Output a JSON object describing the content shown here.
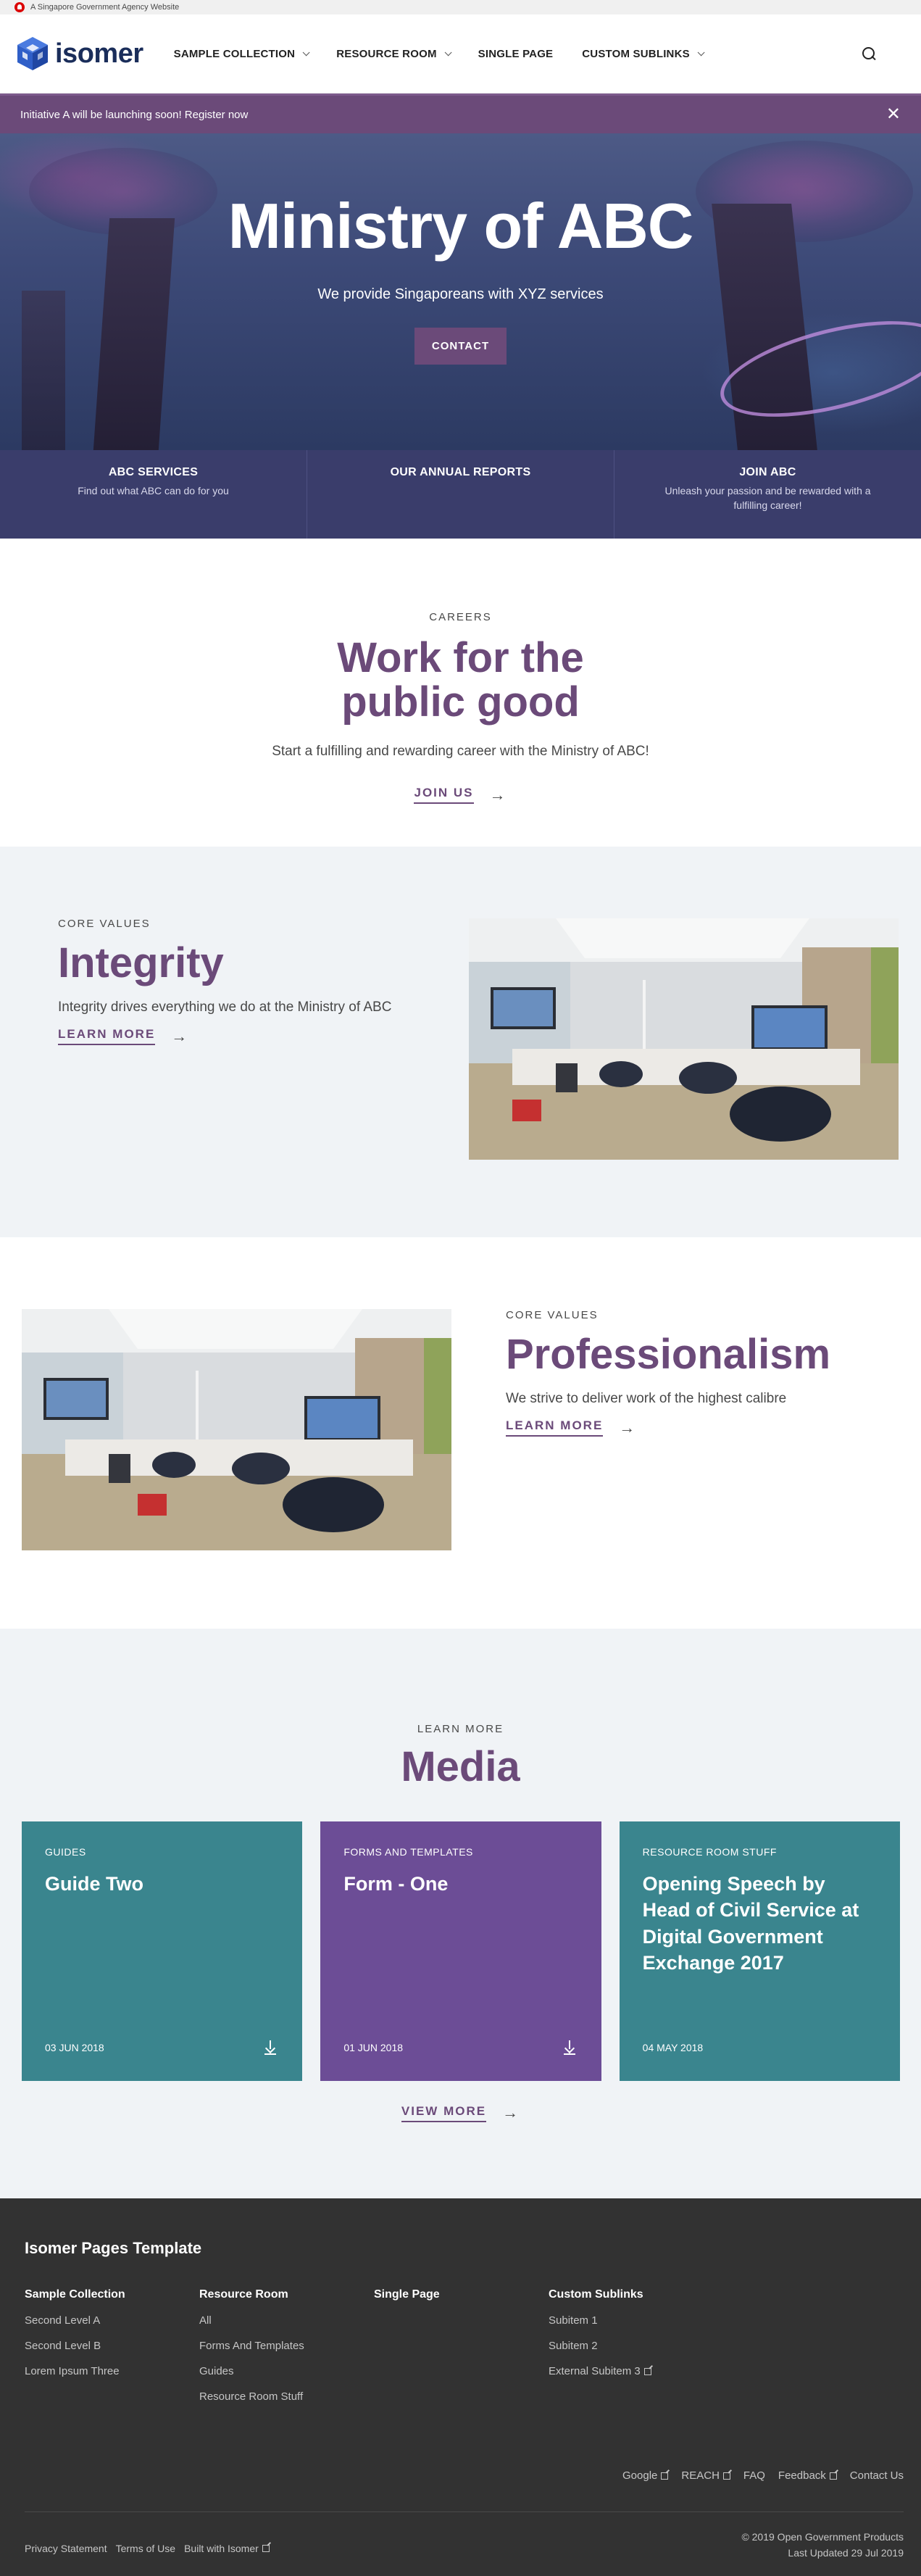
{
  "masthead": {
    "text": "A Singapore Government Agency Website"
  },
  "header": {
    "logo_text": "isomer",
    "nav": [
      {
        "label": "SAMPLE COLLECTION",
        "dropdown": true
      },
      {
        "label": "RESOURCE ROOM",
        "dropdown": true
      },
      {
        "label": "SINGLE PAGE",
        "dropdown": false
      },
      {
        "label": "CUSTOM SUBLINKS",
        "dropdown": true
      }
    ],
    "search_icon": "search-icon"
  },
  "notification": {
    "text": "Initiative A will be launching soon! Register now",
    "close": "✕"
  },
  "hero": {
    "title": "Ministry of ABC",
    "subtitle": "We provide Singaporeans with XYZ services",
    "button": "CONTACT"
  },
  "highlights": [
    {
      "title": "ABC SERVICES",
      "description": "Find out what ABC can do for you"
    },
    {
      "title": "OUR ANNUAL REPORTS",
      "description": ""
    },
    {
      "title": "JOIN ABC",
      "description": "Unleash your passion and be rewarded with a fulfilling career!"
    }
  ],
  "careers": {
    "eyebrow": "CAREERS",
    "title": "Work for the public good",
    "text": "Start a fulfilling and rewarding career with the Ministry of ABC!",
    "link": "JOIN US",
    "arrow": "→"
  },
  "infopics": [
    {
      "eyebrow": "CORE VALUES",
      "title": "Integrity",
      "text": "Integrity drives everything we do at the Ministry of ABC",
      "link": "LEARN MORE",
      "arrow": "→"
    },
    {
      "eyebrow": "CORE VALUES",
      "title": "Professionalism",
      "text": "We strive to deliver work of the highest calibre",
      "link": "LEARN MORE",
      "arrow": "→"
    }
  ],
  "media": {
    "eyebrow": "LEARN MORE",
    "title": "Media",
    "cards": [
      {
        "category": "GUIDES",
        "title": "Guide Two",
        "date": "03 JUN 2018",
        "color": "#3a858e",
        "download": true
      },
      {
        "category": "FORMS AND TEMPLATES",
        "title": "Form - One",
        "date": "01 JUN 2018",
        "color": "#6c4d96",
        "download": true
      },
      {
        "category": "RESOURCE ROOM STUFF",
        "title": "Opening Speech by Head of Civil Service at Digital Government Exchange 2017",
        "date": "04 MAY 2018",
        "color": "#3a858e",
        "download": false
      }
    ],
    "view_more": "VIEW MORE",
    "arrow": "→"
  },
  "footer": {
    "title": "Isomer Pages Template",
    "columns": [
      {
        "heading": "Sample Collection",
        "links": [
          "Second Level A",
          "Second Level B",
          "Lorem Ipsum Three"
        ]
      },
      {
        "heading": "Resource Room",
        "links": [
          "All",
          "Forms And Templates",
          "Guides",
          "Resource Room Stuff"
        ]
      },
      {
        "heading": "Single Page",
        "links": []
      },
      {
        "heading": "Custom Sublinks",
        "links": [
          "Subitem 1",
          "Subitem 2",
          "External Subitem 3"
        ]
      }
    ],
    "links": [
      "Google",
      "REACH",
      "FAQ",
      "Feedback",
      "Contact Us"
    ],
    "legal": [
      "Privacy Statement",
      "Terms of Use",
      "Built with Isomer"
    ],
    "copyright": "© 2019 Open Government Products",
    "last_updated": "Last Updated 29 Jul 2019"
  },
  "colors": {
    "brand": "#6b4a79",
    "highlight_bar": "#3a3d6b",
    "footer": "#323232",
    "section_grey": "#f0f3f6"
  }
}
